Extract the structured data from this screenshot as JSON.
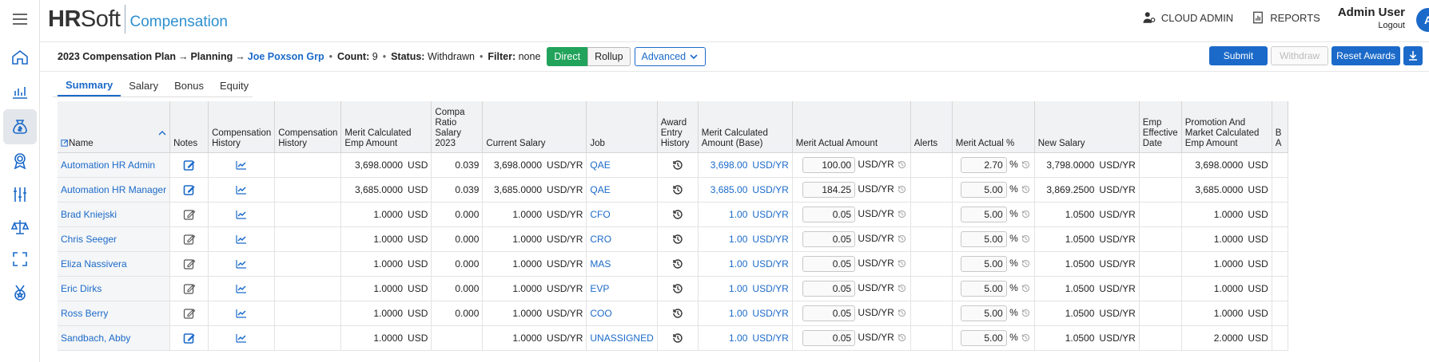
{
  "app": {
    "brand_bold": "HR",
    "brand_regular": "Soft",
    "product": "Compensation",
    "cloud_admin": "CLOUD ADMIN",
    "reports": "REPORTS",
    "user_name": "Admin User",
    "logout": "Logout",
    "avatar_initial": "A"
  },
  "toolbar": {
    "plan": "2023 Compensation Plan",
    "arrow": "→",
    "stage": "Planning",
    "group": "Joe Poxson Grp",
    "count_label": "Count:",
    "count_value": "9",
    "status_label": "Status:",
    "status_value": "Withdrawn",
    "filter_label": "Filter:",
    "filter_value": "none",
    "direct": "Direct",
    "rollup": "Rollup",
    "advanced": "Advanced",
    "submit": "Submit",
    "withdraw": "Withdraw",
    "reset_awards": "Reset Awards"
  },
  "tabs": [
    "Summary",
    "Salary",
    "Bonus",
    "Equity"
  ],
  "columns": {
    "name": "Name",
    "notes": "Notes",
    "comp_history_1": "Compensation History",
    "comp_history_2": "Compensation History",
    "merit_calc_emp": "Merit Calculated Emp Amount",
    "compa_ratio": "Compa Ratio Salary 2023",
    "current_salary": "Current Salary",
    "job": "Job",
    "award_entry": "Award Entry History",
    "merit_calc_base": "Merit Calculated Amount (Base)",
    "merit_actual_amt": "Merit Actual Amount",
    "alerts": "Alerts",
    "merit_actual_pct": "Merit Actual %",
    "new_salary": "New Salary",
    "emp_effective": "Emp Effective Date",
    "promo_market": "Promotion And Market Calculated Emp Amount",
    "next": "B A"
  },
  "rows": [
    {
      "name": "Automation HR Admin",
      "note_filled": true,
      "merit_calc": "3,698.0000",
      "merit_unit": "USD",
      "compa": "0.039",
      "salary": "3,698.0000",
      "salary_unit": "USD/YR",
      "job": "QAE",
      "base": "3,698.00",
      "base_unit": "USD/YR",
      "actual": "100.00",
      "actual_unit": "USD/YR",
      "pct": "2.70",
      "pct_unit": "%",
      "new_salary": "3,798.0000",
      "new_unit": "USD/YR",
      "promo": "3,698.0000",
      "promo_unit": "USD"
    },
    {
      "name": "Automation HR Manager",
      "note_filled": true,
      "merit_calc": "3,685.0000",
      "merit_unit": "USD",
      "compa": "0.039",
      "salary": "3,685.0000",
      "salary_unit": "USD/YR",
      "job": "QAE",
      "base": "3,685.00",
      "base_unit": "USD/YR",
      "actual": "184.25",
      "actual_unit": "USD/YR",
      "pct": "5.00",
      "pct_unit": "%",
      "new_salary": "3,869.2500",
      "new_unit": "USD/YR",
      "promo": "3,685.0000",
      "promo_unit": "USD"
    },
    {
      "name": "Brad Kniejski",
      "note_filled": false,
      "merit_calc": "1.0000",
      "merit_unit": "USD",
      "compa": "0.000",
      "salary": "1.0000",
      "salary_unit": "USD/YR",
      "job": "CFO",
      "base": "1.00",
      "base_unit": "USD/YR",
      "actual": "0.05",
      "actual_unit": "USD/YR",
      "pct": "5.00",
      "pct_unit": "%",
      "new_salary": "1.0500",
      "new_unit": "USD/YR",
      "promo": "1.0000",
      "promo_unit": "USD"
    },
    {
      "name": "Chris Seeger",
      "note_filled": false,
      "merit_calc": "1.0000",
      "merit_unit": "USD",
      "compa": "0.000",
      "salary": "1.0000",
      "salary_unit": "USD/YR",
      "job": "CRO",
      "base": "1.00",
      "base_unit": "USD/YR",
      "actual": "0.05",
      "actual_unit": "USD/YR",
      "pct": "5.00",
      "pct_unit": "%",
      "new_salary": "1.0500",
      "new_unit": "USD/YR",
      "promo": "1.0000",
      "promo_unit": "USD"
    },
    {
      "name": "Eliza Nassivera",
      "note_filled": false,
      "merit_calc": "1.0000",
      "merit_unit": "USD",
      "compa": "0.000",
      "salary": "1.0000",
      "salary_unit": "USD/YR",
      "job": "MAS",
      "base": "1.00",
      "base_unit": "USD/YR",
      "actual": "0.05",
      "actual_unit": "USD/YR",
      "pct": "5.00",
      "pct_unit": "%",
      "new_salary": "1.0500",
      "new_unit": "USD/YR",
      "promo": "1.0000",
      "promo_unit": "USD"
    },
    {
      "name": "Eric Dirks",
      "note_filled": false,
      "merit_calc": "1.0000",
      "merit_unit": "USD",
      "compa": "0.000",
      "salary": "1.0000",
      "salary_unit": "USD/YR",
      "job": "EVP",
      "base": "1.00",
      "base_unit": "USD/YR",
      "actual": "0.05",
      "actual_unit": "USD/YR",
      "pct": "5.00",
      "pct_unit": "%",
      "new_salary": "1.0500",
      "new_unit": "USD/YR",
      "promo": "1.0000",
      "promo_unit": "USD"
    },
    {
      "name": "Ross Berry",
      "note_filled": false,
      "merit_calc": "1.0000",
      "merit_unit": "USD",
      "compa": "0.000",
      "salary": "1.0000",
      "salary_unit": "USD/YR",
      "job": "COO",
      "base": "1.00",
      "base_unit": "USD/YR",
      "actual": "0.05",
      "actual_unit": "USD/YR",
      "pct": "5.00",
      "pct_unit": "%",
      "new_salary": "1.0500",
      "new_unit": "USD/YR",
      "promo": "1.0000",
      "promo_unit": "USD"
    },
    {
      "name": "Sandbach, Abby",
      "note_filled": true,
      "merit_calc": "1.0000",
      "merit_unit": "USD",
      "compa": "",
      "salary": "1.0000",
      "salary_unit": "USD/YR",
      "job": "UNASSIGNED",
      "base": "1.00",
      "base_unit": "USD/YR",
      "actual": "0.05",
      "actual_unit": "USD/YR",
      "pct": "5.00",
      "pct_unit": "%",
      "new_salary": "1.0500",
      "new_unit": "USD/YR",
      "promo": "2.0000",
      "promo_unit": "USD"
    }
  ],
  "icons": {
    "rail": [
      "menu-icon",
      "home-icon",
      "bar-chart-icon",
      "money-bag-icon",
      "award-ribbon-icon",
      "sliders-icon",
      "scales-icon",
      "expand-icon",
      "medal-icon"
    ],
    "notes_filled": "edit-filled-icon",
    "notes_empty": "edit-outline-icon",
    "comp_history": "trend-chart-icon",
    "award_history": "history-icon"
  },
  "colors": {
    "primary": "#1b6ac9",
    "direct_active": "#22a35b",
    "brand_product": "#2d8fd0"
  }
}
